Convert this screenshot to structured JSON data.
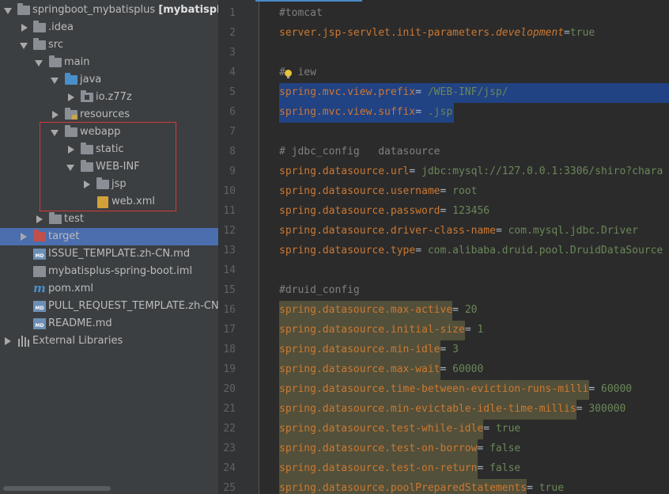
{
  "project_tree": {
    "items": [
      {
        "label": "springboot_mybatisplus",
        "bold_suffix": "[mybatisplus",
        "icon": "module-folder-icon"
      },
      {
        "label": ".idea",
        "icon": "folder-icon"
      },
      {
        "label": "src",
        "icon": "folder-icon"
      },
      {
        "label": "main",
        "icon": "folder-icon"
      },
      {
        "label": "java",
        "icon": "source-folder-icon"
      },
      {
        "label": "io.z77z",
        "icon": "package-icon"
      },
      {
        "label": "resources",
        "icon": "resources-folder-icon"
      },
      {
        "label": "webapp",
        "icon": "folder-icon"
      },
      {
        "label": "static",
        "icon": "folder-icon"
      },
      {
        "label": "WEB-INF",
        "icon": "folder-icon"
      },
      {
        "label": "jsp",
        "icon": "folder-icon"
      },
      {
        "label": "web.xml",
        "icon": "xml-file-icon"
      },
      {
        "label": "test",
        "icon": "folder-icon"
      },
      {
        "label": "target",
        "icon": "excluded-folder-icon"
      },
      {
        "label": "ISSUE_TEMPLATE.zh-CN.md",
        "icon": "markdown-file-icon"
      },
      {
        "label": "mybatisplus-spring-boot.iml",
        "icon": "iml-file-icon"
      },
      {
        "label": "pom.xml",
        "icon": "maven-icon"
      },
      {
        "label": "PULL_REQUEST_TEMPLATE.zh-CN.md",
        "icon": "markdown-file-icon"
      },
      {
        "label": "README.md",
        "icon": "markdown-file-icon"
      },
      {
        "label": "External Libraries",
        "icon": "libraries-icon"
      }
    ],
    "md_badge": "MD"
  },
  "editor": {
    "lines": [
      {
        "num": "1",
        "parts": [
          {
            "t": "#tomcat",
            "c": "com"
          }
        ]
      },
      {
        "num": "2",
        "parts": [
          {
            "t": "server.jsp-servlet.init-parameters.",
            "c": "key"
          },
          {
            "t": "development",
            "c": "ital"
          },
          {
            "t": "=",
            "c": "plain"
          },
          {
            "t": "true",
            "c": "val"
          }
        ]
      },
      {
        "num": "3",
        "parts": []
      },
      {
        "num": "4",
        "parts": [
          {
            "t": "#  iew",
            "c": "com"
          }
        ]
      },
      {
        "num": "5",
        "parts": [
          {
            "t": "spring.mvc.view.prefix",
            "c": "key"
          },
          {
            "t": "= ",
            "c": "plain"
          },
          {
            "t": "/WEB-INF/jsp/",
            "c": "val"
          }
        ]
      },
      {
        "num": "6",
        "parts": [
          {
            "t": "spring.mvc.view.suffix",
            "c": "key"
          },
          {
            "t": "= ",
            "c": "plain"
          },
          {
            "t": ".jsp",
            "c": "val"
          }
        ]
      },
      {
        "num": "7",
        "parts": []
      },
      {
        "num": "8",
        "parts": [
          {
            "t": "# jdbc_config   datasource",
            "c": "com"
          }
        ]
      },
      {
        "num": "9",
        "parts": [
          {
            "t": "spring.datasource.url",
            "c": "key"
          },
          {
            "t": "= ",
            "c": "plain"
          },
          {
            "t": "jdbc:mysql://127.0.0.1:3306/shiro?chara",
            "c": "val"
          }
        ]
      },
      {
        "num": "10",
        "parts": [
          {
            "t": "spring.datasource.username",
            "c": "key"
          },
          {
            "t": "= ",
            "c": "plain"
          },
          {
            "t": "root",
            "c": "val"
          }
        ]
      },
      {
        "num": "11",
        "parts": [
          {
            "t": "spring.datasource.password",
            "c": "key"
          },
          {
            "t": "= ",
            "c": "plain"
          },
          {
            "t": "123456",
            "c": "val"
          }
        ]
      },
      {
        "num": "12",
        "parts": [
          {
            "t": "spring.datasource.driver-class-name",
            "c": "key"
          },
          {
            "t": "= ",
            "c": "plain"
          },
          {
            "t": "com.mysql.jdbc.Driver",
            "c": "val"
          }
        ]
      },
      {
        "num": "13",
        "parts": [
          {
            "t": "spring.datasource.type",
            "c": "key"
          },
          {
            "t": "= ",
            "c": "plain"
          },
          {
            "t": "com.alibaba.druid.pool.DruidDataSource",
            "c": "val"
          }
        ]
      },
      {
        "num": "14",
        "parts": []
      },
      {
        "num": "15",
        "parts": [
          {
            "t": "#druid_config",
            "c": "com"
          }
        ]
      },
      {
        "num": "16",
        "parts": [
          {
            "t": "spring.datasource.max-active",
            "c": "key"
          },
          {
            "t": "= ",
            "c": "plain"
          },
          {
            "t": "20",
            "c": "val"
          }
        ]
      },
      {
        "num": "17",
        "parts": [
          {
            "t": "spring.datasource.initial-size",
            "c": "key"
          },
          {
            "t": "= ",
            "c": "plain"
          },
          {
            "t": "1",
            "c": "val"
          }
        ]
      },
      {
        "num": "18",
        "parts": [
          {
            "t": "spring.datasource.min-idle",
            "c": "key"
          },
          {
            "t": "= ",
            "c": "plain"
          },
          {
            "t": "3",
            "c": "val"
          }
        ]
      },
      {
        "num": "19",
        "parts": [
          {
            "t": "spring.datasource.max-wait",
            "c": "key"
          },
          {
            "t": "= ",
            "c": "plain"
          },
          {
            "t": "60000",
            "c": "val"
          }
        ]
      },
      {
        "num": "20",
        "parts": [
          {
            "t": "spring.datasource.time-between-eviction-runs-milli",
            "c": "key"
          },
          {
            "t": "= ",
            "c": "plain"
          },
          {
            "t": "60000",
            "c": "val"
          }
        ]
      },
      {
        "num": "21",
        "parts": [
          {
            "t": "spring.datasource.min-evictable-idle-time-millis",
            "c": "key"
          },
          {
            "t": "= ",
            "c": "plain"
          },
          {
            "t": "300000",
            "c": "val"
          }
        ]
      },
      {
        "num": "22",
        "parts": [
          {
            "t": "spring.datasource.test-while-idle",
            "c": "key"
          },
          {
            "t": "= ",
            "c": "plain"
          },
          {
            "t": "true",
            "c": "val"
          }
        ]
      },
      {
        "num": "23",
        "parts": [
          {
            "t": "spring.datasource.test-on-borrow",
            "c": "key"
          },
          {
            "t": "= ",
            "c": "plain"
          },
          {
            "t": "false",
            "c": "val"
          }
        ]
      },
      {
        "num": "24",
        "parts": [
          {
            "t": "spring.datasource.test-on-return",
            "c": "key"
          },
          {
            "t": "= ",
            "c": "plain"
          },
          {
            "t": "false",
            "c": "val"
          }
        ]
      },
      {
        "num": "25",
        "parts": [
          {
            "t": "spring.datasource.poolPreparedStatements",
            "c": "key"
          },
          {
            "t": "= ",
            "c": "plain"
          },
          {
            "t": "true",
            "c": "val"
          }
        ]
      }
    ]
  },
  "colors": {
    "selection": "#214283",
    "duplicate_highlight": "#52503a",
    "annotation_box": "#d43a3a",
    "tree_selected": "#4b6eaf"
  }
}
